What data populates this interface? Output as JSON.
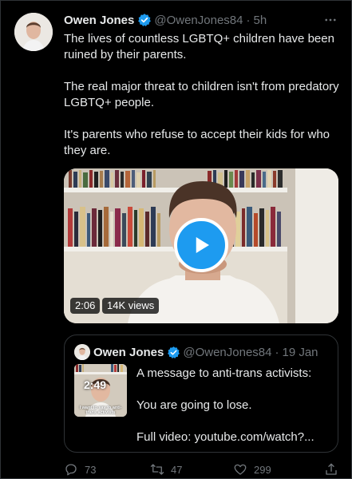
{
  "tweet": {
    "author_name": "Owen Jones",
    "author_handle": "@OwenJones84",
    "separator": "·",
    "time": "5h",
    "text": [
      "The lives of countless LGBTQ+ children have been ruined by their parents.",
      "The real major threat to children isn't from predatory LGBTQ+ people.",
      "It's parents who refuse to accept their kids for who they are."
    ],
    "video": {
      "duration": "2:06",
      "views": "14K views"
    },
    "actions": {
      "replies": "73",
      "retweets": "47",
      "likes": "299"
    }
  },
  "quoted_tweet": {
    "author_name": "Owen Jones",
    "author_handle": "@OwenJones84",
    "separator": "·",
    "date": "19 Jan",
    "thumbnail": {
      "duration": "2:49",
      "caption": "I want to say to anti-trans activists"
    },
    "text": [
      "A message to anti-trans activists:",
      "You are going to lose.",
      "Full video: youtube.com/watch?..."
    ]
  },
  "colors": {
    "background": "#000000",
    "text": "#e7e9ea",
    "muted": "#71767b",
    "accent": "#1d9bf0",
    "border": "#2f3336"
  },
  "icons": [
    "verified-badge-icon",
    "more-icon",
    "play-icon",
    "reply-icon",
    "retweet-icon",
    "like-icon",
    "share-icon"
  ]
}
